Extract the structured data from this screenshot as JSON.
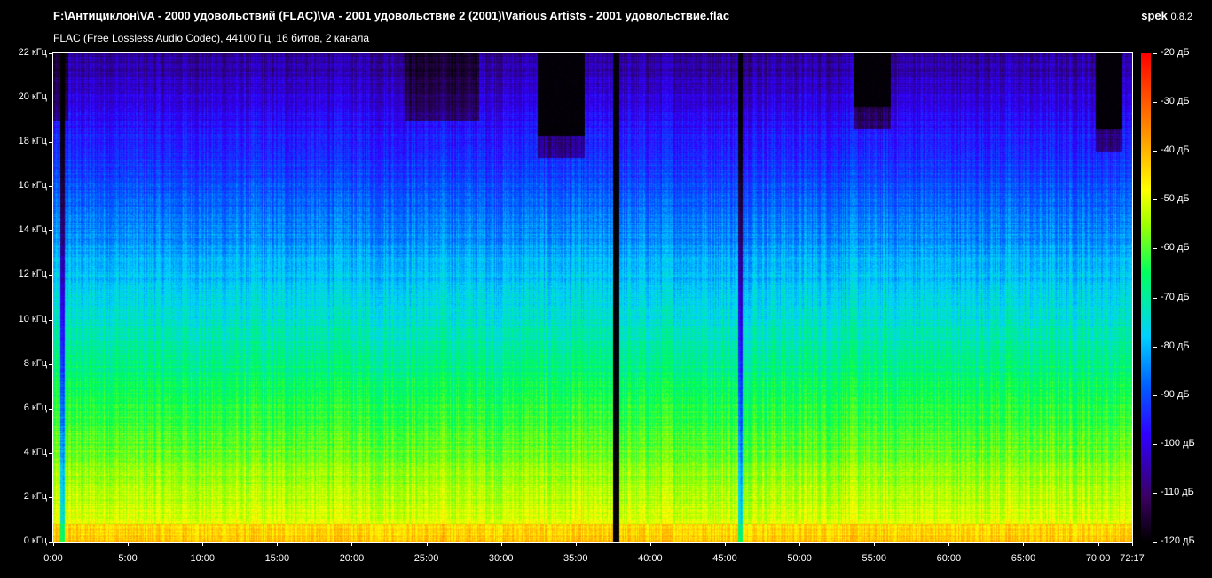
{
  "header": {
    "file_path": "F:\\Антициклон\\VA - 2000 удовольствий (FLAC)\\VA - 2001 удовольствие 2 (2001)\\Various Artists - 2001 удовольствие.flac",
    "stream_info": "FLAC (Free Lossless Audio Codec), 44100 Гц, 16 битов, 2 канала",
    "app_name": "spek",
    "app_version": "0.8.2"
  },
  "axes": {
    "frequency_labels": [
      "0 кГц",
      "2 кГц",
      "4 кГц",
      "6 кГц",
      "8 кГц",
      "10 кГц",
      "12 кГц",
      "14 кГц",
      "16 кГц",
      "18 кГц",
      "20 кГц",
      "22 кГц"
    ],
    "time_labels": [
      "0:00",
      "5:00",
      "10:00",
      "15:00",
      "20:00",
      "25:00",
      "30:00",
      "35:00",
      "40:00",
      "45:00",
      "50:00",
      "55:00",
      "60:00",
      "65:00",
      "70:00"
    ],
    "time_end_label": "72:17",
    "duration_seconds": 4337,
    "max_frequency_khz": 22,
    "db_labels": [
      "-20 дБ",
      "-30 дБ",
      "-40 дБ",
      "-50 дБ",
      "-60 дБ",
      "-70 дБ",
      "-80 дБ",
      "-90 дБ",
      "-100 дБ",
      "-110 дБ",
      "-120 дБ"
    ]
  },
  "colors": {
    "background": "#000000",
    "text": "#ffffff"
  }
}
